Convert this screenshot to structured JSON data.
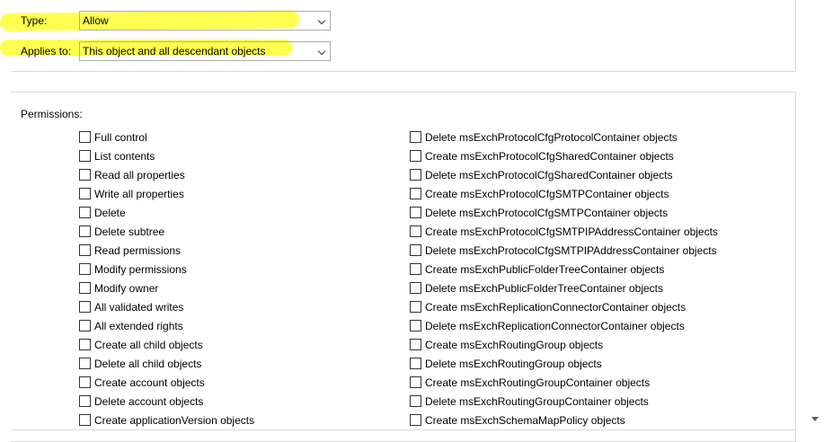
{
  "type_field": {
    "label": "Type:",
    "value": "Allow"
  },
  "applies_field": {
    "label": "Applies to:",
    "value": "This object and all descendant objects"
  },
  "permissions": {
    "title": "Permissions:",
    "left": [
      "Full control",
      "List contents",
      "Read all properties",
      "Write all properties",
      "Delete",
      "Delete subtree",
      "Read permissions",
      "Modify permissions",
      "Modify owner",
      "All validated writes",
      "All extended rights",
      "Create all child objects",
      "Delete all child objects",
      "Create account objects",
      "Delete account objects",
      "Create applicationVersion objects"
    ],
    "right": [
      "Delete msExchProtocolCfgProtocolContainer objects",
      "Create msExchProtocolCfgSharedContainer objects",
      "Delete msExchProtocolCfgSharedContainer objects",
      "Create msExchProtocolCfgSMTPContainer objects",
      "Delete msExchProtocolCfgSMTPContainer objects",
      "Create msExchProtocolCfgSMTPIPAddressContainer objects",
      "Delete msExchProtocolCfgSMTPIPAddressContainer objects",
      "Create msExchPublicFolderTreeContainer objects",
      "Delete msExchPublicFolderTreeContainer objects",
      "Create msExchReplicationConnectorContainer objects",
      "Delete msExchReplicationConnectorContainer objects",
      "Create msExchRoutingGroup objects",
      "Delete msExchRoutingGroup objects",
      "Create msExchRoutingGroupContainer objects",
      "Delete msExchRoutingGroupContainer objects",
      "Create msExchSchemaMapPolicy objects"
    ]
  },
  "colors": {
    "highlight": "#ffff33",
    "border": "#d9d9d9",
    "combo_border": "#adadad"
  },
  "icons": {
    "combo_arrow": "chevron-down-icon",
    "scroll_arrow": "scroll-down-arrow-icon"
  }
}
